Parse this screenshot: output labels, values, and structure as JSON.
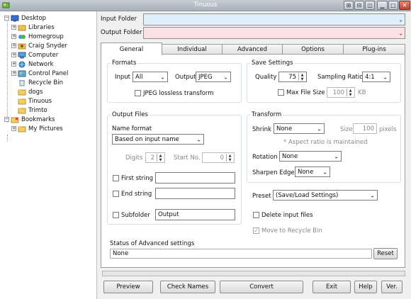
{
  "window": {
    "title": "Tinuous"
  },
  "tree": [
    {
      "label": "Desktop",
      "icon": "desktop-icon",
      "expander": "−"
    },
    {
      "label": "Libraries",
      "icon": "libraries-icon",
      "expander": "+"
    },
    {
      "label": "Homegroup",
      "icon": "homegroup-icon",
      "expander": "+"
    },
    {
      "label": "Craig Snyder",
      "icon": "user-folder-icon",
      "expander": "+"
    },
    {
      "label": "Computer",
      "icon": "computer-icon",
      "expander": "+"
    },
    {
      "label": "Network",
      "icon": "network-icon",
      "expander": "+"
    },
    {
      "label": "Control Panel",
      "icon": "control-panel-icon",
      "expander": "+"
    },
    {
      "label": "Recycle Bin",
      "icon": "recycle-bin-icon",
      "expander": ""
    },
    {
      "label": "dogs",
      "icon": "folder-icon",
      "expander": ""
    },
    {
      "label": "Tinuous",
      "icon": "folder-icon",
      "expander": ""
    },
    {
      "label": "Trimto",
      "icon": "folder-icon",
      "expander": ""
    },
    {
      "label": "Bookmarks",
      "icon": "bookmarks-icon",
      "expander": "−"
    },
    {
      "label": "My Pictures",
      "icon": "folder-icon",
      "expander": "+"
    }
  ],
  "input_folder": {
    "label": "Input Folder",
    "value": "",
    "color": "#dff0fb"
  },
  "output_folder": {
    "label": "Output Folder",
    "value": "",
    "color": "#fbe1e6"
  },
  "tabs": [
    "General",
    "Individual",
    "Advanced",
    "Options",
    "Plug-ins"
  ],
  "active_tab": "General",
  "formats": {
    "legend": "Formats",
    "input_label": "Input",
    "input_value": "All",
    "output_label": "Output",
    "output_value": "JPEG",
    "lossless_label": "JPEG lossless transform"
  },
  "save_settings": {
    "legend": "Save Settings",
    "quality_label": "Quality",
    "quality_value": "75",
    "sampling_label": "Sampling Ratio",
    "sampling_value": "4:1",
    "max_file_size_label": "Max File Size",
    "max_file_size_value": "100",
    "max_file_size_unit": "KB"
  },
  "output_files": {
    "legend": "Output Files",
    "name_format_label": "Name format",
    "name_format_value": "Based on input name",
    "digits_label": "Digits",
    "digits_value": "2",
    "start_no_label": "Start No.",
    "start_no_value": "0",
    "first_string_label": "First string",
    "first_string_value": "",
    "end_string_label": "End string",
    "end_string_value": "",
    "subfolder_label": "Subfolder",
    "subfolder_value": "Output"
  },
  "transform": {
    "legend": "Transform",
    "shrink_label": "Shrink",
    "shrink_value": "None",
    "size_label": "Size",
    "size_value": "100",
    "size_unit": "pixels",
    "aspect_note": "* Aspect ratio is maintained",
    "rotation_label": "Rotation",
    "rotation_value": "None",
    "sharpen_label": "Sharpen Edge",
    "sharpen_value": "None"
  },
  "preset": {
    "label": "Preset",
    "value": "(Save/Load Settings)"
  },
  "delete_input_label": "Delete input files",
  "move_recycle_label": "Move to Recycle Bin",
  "advanced_status": {
    "label": "Status of Advanced settings",
    "value": "None",
    "reset_label": "Reset"
  },
  "progress": {
    "fraction": 0.0
  },
  "buttons": {
    "preview": "Preview",
    "check_names": "Check Names",
    "convert": "Convert",
    "exit": "Exit",
    "help": "Help",
    "ver": "Ver."
  },
  "colors": {
    "accent": "#3cb04a",
    "titlebar": "#b5bdc4",
    "close": "#c1422d"
  }
}
